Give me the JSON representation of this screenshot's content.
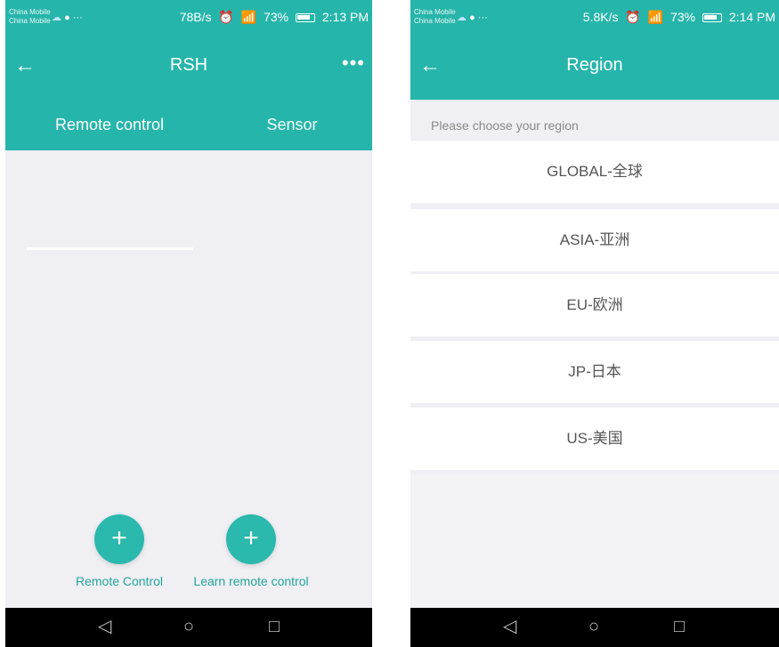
{
  "left": {
    "status": {
      "carrier1": "China Mobile",
      "carrier2": "China Mobile",
      "speed": "78B/s",
      "battery": "73%",
      "time": "2:13 PM"
    },
    "title": "RSH",
    "tabs": [
      "Remote control",
      "Sensor"
    ],
    "actions": [
      {
        "label": "Remote Control"
      },
      {
        "label": "Learn remote control"
      }
    ]
  },
  "right": {
    "status": {
      "carrier1": "China Mobile",
      "carrier2": "China Mobile",
      "speed": "5.8K/s",
      "battery": "73%",
      "time": "2:14 PM"
    },
    "title": "Region",
    "hint": "Please choose your region",
    "regions": [
      "GLOBAL-全球",
      "ASIA-亚洲",
      "EU-欧洲",
      "JP-日本",
      "US-美国"
    ]
  },
  "colors": {
    "primary": "#26b5aa",
    "accent_text": "#25a59b",
    "background": "#efeff4"
  },
  "icons": {
    "back": "arrow-left",
    "more": "three-dots",
    "fab": "plus",
    "nav_back": "triangle",
    "nav_home": "circle",
    "nav_recent": "square"
  }
}
